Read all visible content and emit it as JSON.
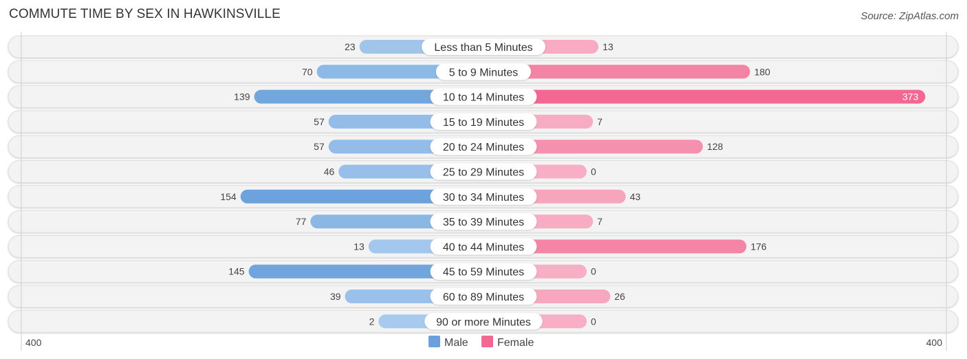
{
  "chart_data": {
    "type": "bar",
    "orientation": "horizontal-diverging",
    "title": "COMMUTE TIME BY SEX IN HAWKINSVILLE",
    "source": "Source: ZipAtlas.com",
    "categories": [
      "Less than 5 Minutes",
      "5 to 9 Minutes",
      "10 to 14 Minutes",
      "15 to 19 Minutes",
      "20 to 24 Minutes",
      "25 to 29 Minutes",
      "30 to 34 Minutes",
      "35 to 39 Minutes",
      "40 to 44 Minutes",
      "45 to 59 Minutes",
      "60 to 89 Minutes",
      "90 or more Minutes"
    ],
    "series": [
      {
        "name": "Male",
        "color": "#6aa1dc",
        "values": [
          23,
          70,
          139,
          57,
          57,
          46,
          154,
          77,
          13,
          145,
          39,
          2
        ]
      },
      {
        "name": "Female",
        "color": "#f26892",
        "values": [
          13,
          180,
          373,
          7,
          128,
          0,
          43,
          7,
          176,
          0,
          26,
          0
        ]
      }
    ],
    "axis": {
      "left_label": "400",
      "right_label": "400",
      "max": 400
    },
    "legend": {
      "position": "bottom-center",
      "items": [
        "Male",
        "Female"
      ]
    }
  }
}
